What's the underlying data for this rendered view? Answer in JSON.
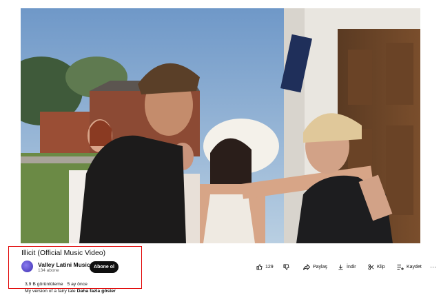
{
  "video": {
    "title": "Illicit (Official Music Video)"
  },
  "channel": {
    "name": "Valley Latini Music",
    "subscribers": "134 abone",
    "subscribe_label": "Abone ol"
  },
  "actions": {
    "like_count": "129",
    "share_label": "Paylaş",
    "download_label": "İndir",
    "clip_label": "Klip",
    "save_label": "Kaydet"
  },
  "description": {
    "views": "3,9 B görüntüleme",
    "age": "5 ay önce",
    "text": "My version of a fairy tale",
    "more_label": "Daha fazla göster"
  },
  "colors": {
    "highlight": "#e00000",
    "subscribe_bg": "#0f0f0f",
    "avatar": "#5a4ad0"
  }
}
